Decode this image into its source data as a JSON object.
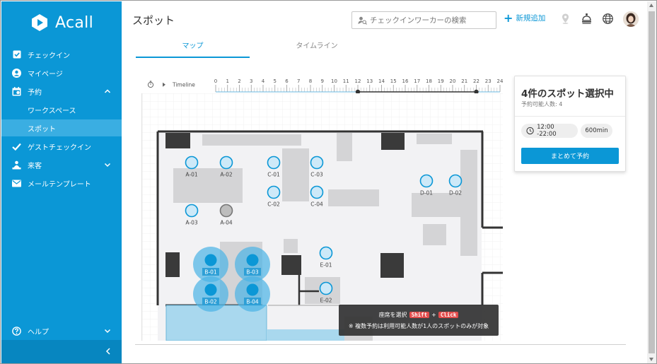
{
  "app": {
    "logo_text": "Acall"
  },
  "sidebar": {
    "items": [
      {
        "label": "チェックイン",
        "icon": "checkbox-icon"
      },
      {
        "label": "マイページ",
        "icon": "user-circle-icon"
      },
      {
        "label": "予約",
        "icon": "calendar-icon",
        "expanded": true
      },
      {
        "label": "ワークスペース",
        "sub": true
      },
      {
        "label": "スポット",
        "sub": true,
        "active": true
      },
      {
        "label": "ゲストチェックイン",
        "icon": "check-icon"
      },
      {
        "label": "来客",
        "icon": "people-icon"
      },
      {
        "label": "メールテンプレート",
        "icon": "mail-icon"
      }
    ],
    "help_label": "ヘルプ"
  },
  "header": {
    "title": "スポット",
    "search_placeholder": "チェックインワーカーの検索",
    "add_new_label": "新規追加"
  },
  "tabs": [
    {
      "label": "マップ",
      "active": true
    },
    {
      "label": "タイムライン",
      "active": false
    }
  ],
  "timeline": {
    "label": "Timeline",
    "ticks": [
      "0",
      "1",
      "2",
      "3",
      "4",
      "5",
      "6",
      "7",
      "8",
      "9",
      "10",
      "11",
      "12",
      "13",
      "14",
      "15",
      "16",
      "17",
      "18",
      "19",
      "20",
      "21",
      "22",
      "23",
      "24"
    ],
    "selected_start": 12,
    "selected_end": 22
  },
  "spots": [
    {
      "label": "A-01",
      "state": "available"
    },
    {
      "label": "A-02",
      "state": "available"
    },
    {
      "label": "A-03",
      "state": "available"
    },
    {
      "label": "A-04",
      "state": "unavailable"
    },
    {
      "label": "C-01",
      "state": "available"
    },
    {
      "label": "C-02",
      "state": "available"
    },
    {
      "label": "C-03",
      "state": "available"
    },
    {
      "label": "C-04",
      "state": "available"
    },
    {
      "label": "D-01",
      "state": "available"
    },
    {
      "label": "D-02",
      "state": "available"
    },
    {
      "label": "E-01",
      "state": "available"
    },
    {
      "label": "E-02",
      "state": "available"
    },
    {
      "label": "B-01",
      "state": "selected"
    },
    {
      "label": "B-02",
      "state": "selected"
    },
    {
      "label": "B-03",
      "state": "selected"
    },
    {
      "label": "B-04",
      "state": "selected"
    }
  ],
  "panel": {
    "title": "4件のスポット選択中",
    "capacity_label": "予約可能人数: 4",
    "time_range": "12:00 -22:00",
    "duration": "600min",
    "book_button": "まとめて予約"
  },
  "hint": {
    "line1_prefix": "座席を選択",
    "key1": "Shift",
    "plus": "+",
    "key2": "Click",
    "line2": "※ 複数予約は利用可能人数が1人のスポットのみが対象"
  },
  "colors": {
    "brand": "#0b97d6",
    "sidebar_active": "#3aaee2",
    "spot_available": "#cde9f8",
    "spot_selected": "#0b97d6",
    "spot_unavailable": "#bdbdbd"
  }
}
